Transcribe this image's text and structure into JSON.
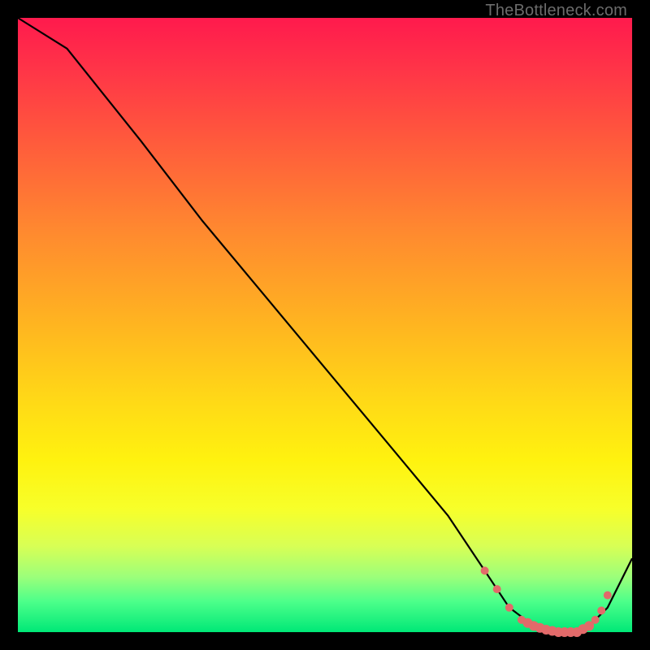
{
  "watermark": "TheBottleneck.com",
  "chart_data": {
    "type": "line",
    "title": "",
    "xlabel": "",
    "ylabel": "",
    "xlim": [
      0,
      100
    ],
    "ylim": [
      0,
      100
    ],
    "series": [
      {
        "name": "curve",
        "x": [
          0,
          8,
          12,
          20,
          30,
          40,
          50,
          60,
          70,
          76,
          80,
          84,
          88,
          92,
          96,
          100
        ],
        "values": [
          100,
          95,
          90,
          80,
          67,
          55,
          43,
          31,
          19,
          10,
          4,
          1,
          0,
          0,
          4,
          12
        ]
      }
    ],
    "markers": {
      "name": "highlight-dots",
      "color": "#e26a6a",
      "x": [
        76,
        78,
        80,
        82,
        83,
        84,
        85,
        86,
        87,
        88,
        89,
        90,
        91,
        92,
        93,
        94,
        95,
        96
      ],
      "values": [
        10,
        7,
        4,
        2,
        1.5,
        1,
        0.7,
        0.4,
        0.2,
        0,
        0,
        0,
        0,
        0.5,
        1,
        2,
        3.5,
        6
      ]
    }
  }
}
